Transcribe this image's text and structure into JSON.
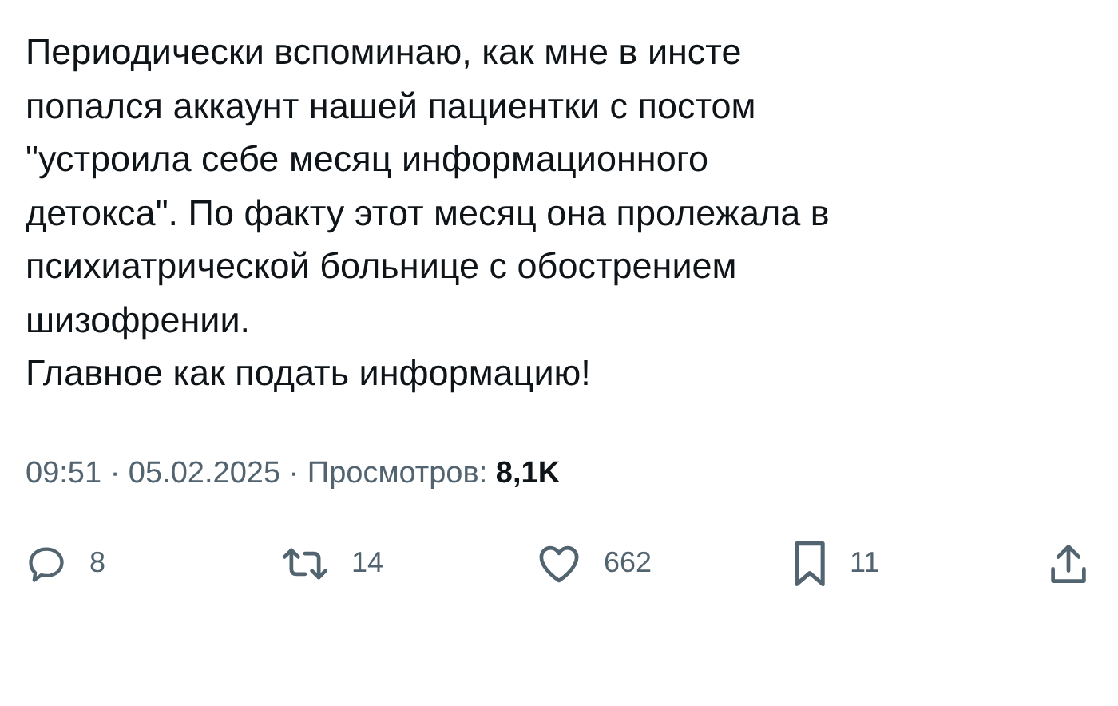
{
  "post": {
    "paragraphs": [
      {
        "lines": [
          "Периодически вспоминаю, как мне в инсте",
          "попался аккаунт нашей пациентки с постом",
          "\"устроила себе месяц информационного",
          "детокса\". По факту этот месяц она пролежала в",
          "психиатрической больнице с обострением",
          "шизофрении."
        ]
      },
      {
        "lines": [
          "Главное как подать информацию!"
        ]
      }
    ],
    "meta": "09:51 · 05.02.2025 · Просмотров: **8,1K**"
  },
  "actions": [
    {
      "kind": "reply",
      "count": "8"
    },
    {
      "kind": "repost",
      "count": "14"
    },
    {
      "kind": "like",
      "count": "662"
    },
    {
      "kind": "bookmark",
      "count": "11"
    },
    {
      "kind": "share"
    }
  ]
}
